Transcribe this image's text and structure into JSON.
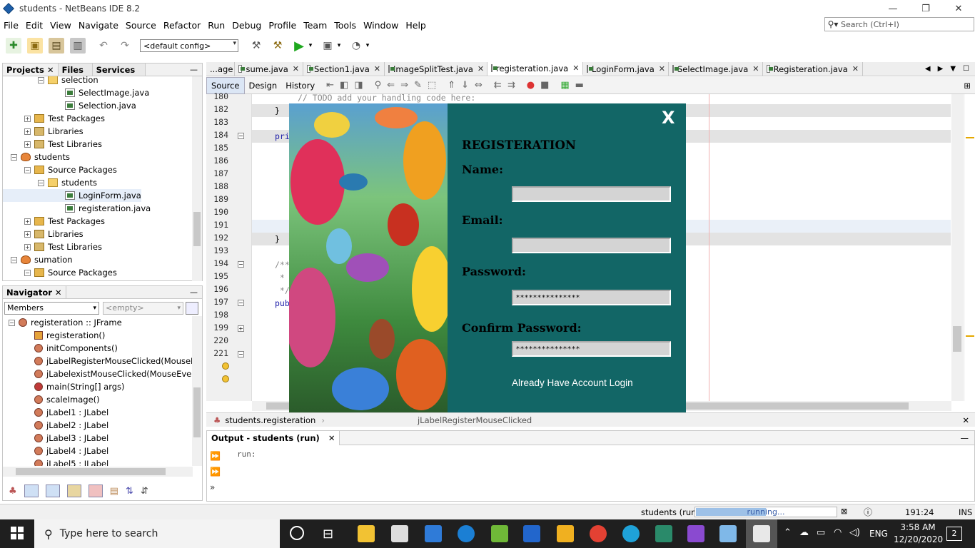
{
  "window": {
    "title": "students - NetBeans IDE 8.2",
    "minimize": "—",
    "restore": "❐",
    "close": "✕"
  },
  "menu": [
    "File",
    "Edit",
    "View",
    "Navigate",
    "Source",
    "Refactor",
    "Run",
    "Debug",
    "Profile",
    "Team",
    "Tools",
    "Window",
    "Help"
  ],
  "search": {
    "placeholder": "Search (Ctrl+I)"
  },
  "toolbar": {
    "config": "<default config>"
  },
  "projects_panel": {
    "tabs": [
      "Projects",
      "Files",
      "Services"
    ],
    "tree": [
      {
        "label": "selection",
        "type": "pkg",
        "indent": 3
      },
      {
        "label": "SelectImage.java",
        "type": "java",
        "indent": 5
      },
      {
        "label": "Selection.java",
        "type": "java",
        "indent": 5
      },
      {
        "label": "Test Packages",
        "type": "folder",
        "indent": 2
      },
      {
        "label": "Libraries",
        "type": "lib",
        "indent": 2
      },
      {
        "label": "Test Libraries",
        "type": "lib",
        "indent": 2
      },
      {
        "label": "students",
        "type": "proj",
        "indent": 1
      },
      {
        "label": "Source Packages",
        "type": "folder",
        "indent": 2
      },
      {
        "label": "students",
        "type": "pkg",
        "indent": 3
      },
      {
        "label": "LoginForm.java",
        "type": "java",
        "indent": 5
      },
      {
        "label": "registeration.java",
        "type": "java",
        "indent": 5
      },
      {
        "label": "Test Packages",
        "type": "folder",
        "indent": 2
      },
      {
        "label": "Libraries",
        "type": "lib",
        "indent": 2
      },
      {
        "label": "Test Libraries",
        "type": "lib",
        "indent": 2
      },
      {
        "label": "sumation",
        "type": "proj",
        "indent": 1
      },
      {
        "label": "Source Packages",
        "type": "folder",
        "indent": 2
      }
    ]
  },
  "navigator": {
    "title": "Navigator",
    "members": "Members",
    "filter": "<empty>",
    "items": [
      {
        "label": "registeration :: JFrame",
        "indent": 1
      },
      {
        "label": "registeration()",
        "indent": 2
      },
      {
        "label": "initComponents()",
        "indent": 2
      },
      {
        "label": "jLabelRegisterMouseClicked(MouseEvent e",
        "indent": 2
      },
      {
        "label": "jLabelexistMouseClicked(MouseEvent evt)",
        "indent": 2
      },
      {
        "label": "main(String[] args)",
        "indent": 2
      },
      {
        "label": "scaleImage()",
        "indent": 2
      },
      {
        "label": "jLabel1 : JLabel",
        "indent": 2
      },
      {
        "label": "jLabel2 : JLabel",
        "indent": 2
      },
      {
        "label": "jLabel3 : JLabel",
        "indent": 2
      },
      {
        "label": "jLabel4 : JLabel",
        "indent": 2
      },
      {
        "label": "jLabel5 : JLabel",
        "indent": 2
      }
    ]
  },
  "editor": {
    "tabs": [
      "...age",
      "sume.java",
      "Section1.java",
      "ImageSplitTest.java",
      "registeration.java",
      "LoginForm.java",
      "SelectImage.java",
      "Registeration.java"
    ],
    "active_tab": 4,
    "subtabs": [
      "Source",
      "Design",
      "History"
    ],
    "line_numbers": [
      "180",
      "182",
      "183",
      "184",
      "185",
      "186",
      "187",
      "188",
      "189",
      "190",
      "191",
      "192",
      "193",
      "194",
      "195",
      "196",
      "197",
      "198",
      "199",
      "220",
      "221"
    ],
    "code_fragments": [
      {
        "line": 0,
        "text": "// TODO add your handling code here:"
      },
      {
        "line": 1,
        "text": "}"
      },
      {
        "line": 3,
        "text": "pri"
      },
      {
        "line": 11,
        "text": "}"
      },
      {
        "line": 13,
        "text": "/**"
      },
      {
        "line": 14,
        "text": " *"
      },
      {
        "line": 15,
        "text": " */"
      },
      {
        "line": 16,
        "text": "pub"
      }
    ]
  },
  "form": {
    "close": "X",
    "heading": "REGISTERATION",
    "name_label": "Name:",
    "email_label": "Email:",
    "password_label": "Password:",
    "confirm_label": "Confirm Password:",
    "password_value": "***************",
    "confirm_value": "***************",
    "login_link": "Already Have Account Login"
  },
  "breadcrumb": [
    "students.registeration",
    "jLabelRegisterMouseClicked"
  ],
  "output": {
    "title": "Output - students (run)",
    "text": "run:"
  },
  "status": {
    "project": "students (run)",
    "progress_text": "running...",
    "progress": 0.5,
    "position": "191:24",
    "mode": "INS"
  },
  "taskbar": {
    "search_placeholder": "Type here to search",
    "time": "3:58 AM",
    "date": "12/20/2020",
    "lang": "ENG",
    "notifications": "2"
  }
}
